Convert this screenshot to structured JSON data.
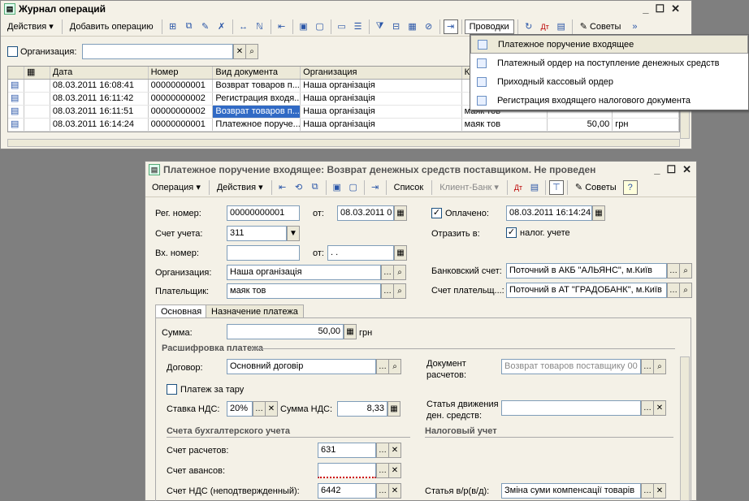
{
  "journal": {
    "title": "Журнал операций",
    "toolbar": {
      "actions": "Действия",
      "add_operation": "Добавить операцию",
      "postings": "Проводки",
      "advice": "Советы"
    },
    "filter": {
      "organization_label": "Организация:",
      "organization_value": ""
    },
    "columns": [
      "",
      "",
      "Дата",
      "Номер",
      "Вид документа",
      "Организация",
      "К",
      "",
      ""
    ],
    "rows": [
      {
        "date": "08.03.2011 16:08:41",
        "num": "00000000001",
        "type": "Возврат товаров п...",
        "org": "Наша організація",
        "k": "",
        "sum": "",
        "cur": ""
      },
      {
        "date": "08.03.2011 16:11:42",
        "num": "00000000002",
        "type": "Регистрация входя...",
        "org": "Наша організація",
        "k": "",
        "sum": "",
        "cur": ""
      },
      {
        "date": "08.03.2011 16:11:51",
        "num": "00000000002",
        "type": "Возврат товаров п...",
        "org": "Наша організація",
        "k": "маяк тов",
        "sum": "",
        "cur": ""
      },
      {
        "date": "08.03.2011 16:14:24",
        "num": "00000000001",
        "type": "Платежное поруче...",
        "org": "Наша організація",
        "k": "маяк тов",
        "sum": "50,00",
        "cur": "грн"
      }
    ]
  },
  "menu": {
    "items": [
      "Платежное поручение входящее",
      "Платежный ордер на поступление денежных средств",
      "Приходный кассовый ордер",
      "Регистрация входящего налогового документа"
    ]
  },
  "doc": {
    "title": "Платежное поручение входящее: Возврат денежных средств поставщиком. Не проведен",
    "toolbar": {
      "operation": "Операция",
      "actions": "Действия",
      "list": "Список",
      "client_bank": "Клиент-Банк",
      "advice": "Советы"
    },
    "reg_num_label": "Рег. номер:",
    "reg_num": "00000000001",
    "from_label": "от:",
    "from_date": "08.03.2011 0",
    "paid_label": "Оплачено:",
    "paid_date": "08.03.2011 16:14:24",
    "account_label": "Счет учета:",
    "account": "311",
    "reflect_label": "Отразить в:",
    "tax_label": "налог. учете",
    "in_num_label": "Вх. номер:",
    "in_num": "",
    "in_from_label": "от:",
    "in_from": ". .",
    "org_label": "Организация:",
    "org": "Наша організація",
    "bank_label": "Банковский счет:",
    "bank": "Поточний в АКБ \"АЛЬЯНС\", м.Київ",
    "payer_label": "Плательщик:",
    "payer": "маяк тов",
    "payer_acc_label": "Счет плательщ...:",
    "payer_acc": "Поточний в АТ \"ГРАДОБАНК\", м.Київ",
    "tabs": [
      "Основная",
      "Назначение платежа"
    ],
    "sum_label": "Сумма:",
    "sum": "50,00",
    "currency": "грн",
    "section_decode": "Расшифровка платежа",
    "contract_label": "Договор:",
    "contract": "Основний договір",
    "settle_doc_label1": "Документ",
    "settle_doc_label2": "расчетов:",
    "settle_doc": "Возврат товаров поставщику 00",
    "tara_label": "Платеж за тару",
    "vat_rate_label": "Ставка НДС:",
    "vat_rate": "20%",
    "vat_sum_label": "Сумма НДС:",
    "vat_sum": "8,33",
    "cash_label1": "Статья движения",
    "cash_label2": "ден. средств:",
    "cash": "",
    "section_accounts": "Счета бухгалтерского учета",
    "section_tax": "Налоговый учет",
    "settle_acc_label": "Счет расчетов:",
    "settle_acc": "631",
    "adv_acc_label": "Счет авансов:",
    "adv_acc": "",
    "vat_acc_label": "Счет НДС (неподтвержденный):",
    "vat_acc": "6442",
    "tax_item_label": "Статья в/р(в/д):",
    "tax_item": "Зміна суми компенсації товарів"
  },
  "colors": {
    "selection": "#316ac5",
    "window_bg": "#f4f1e7",
    "desktop": "#7f7f7f"
  }
}
